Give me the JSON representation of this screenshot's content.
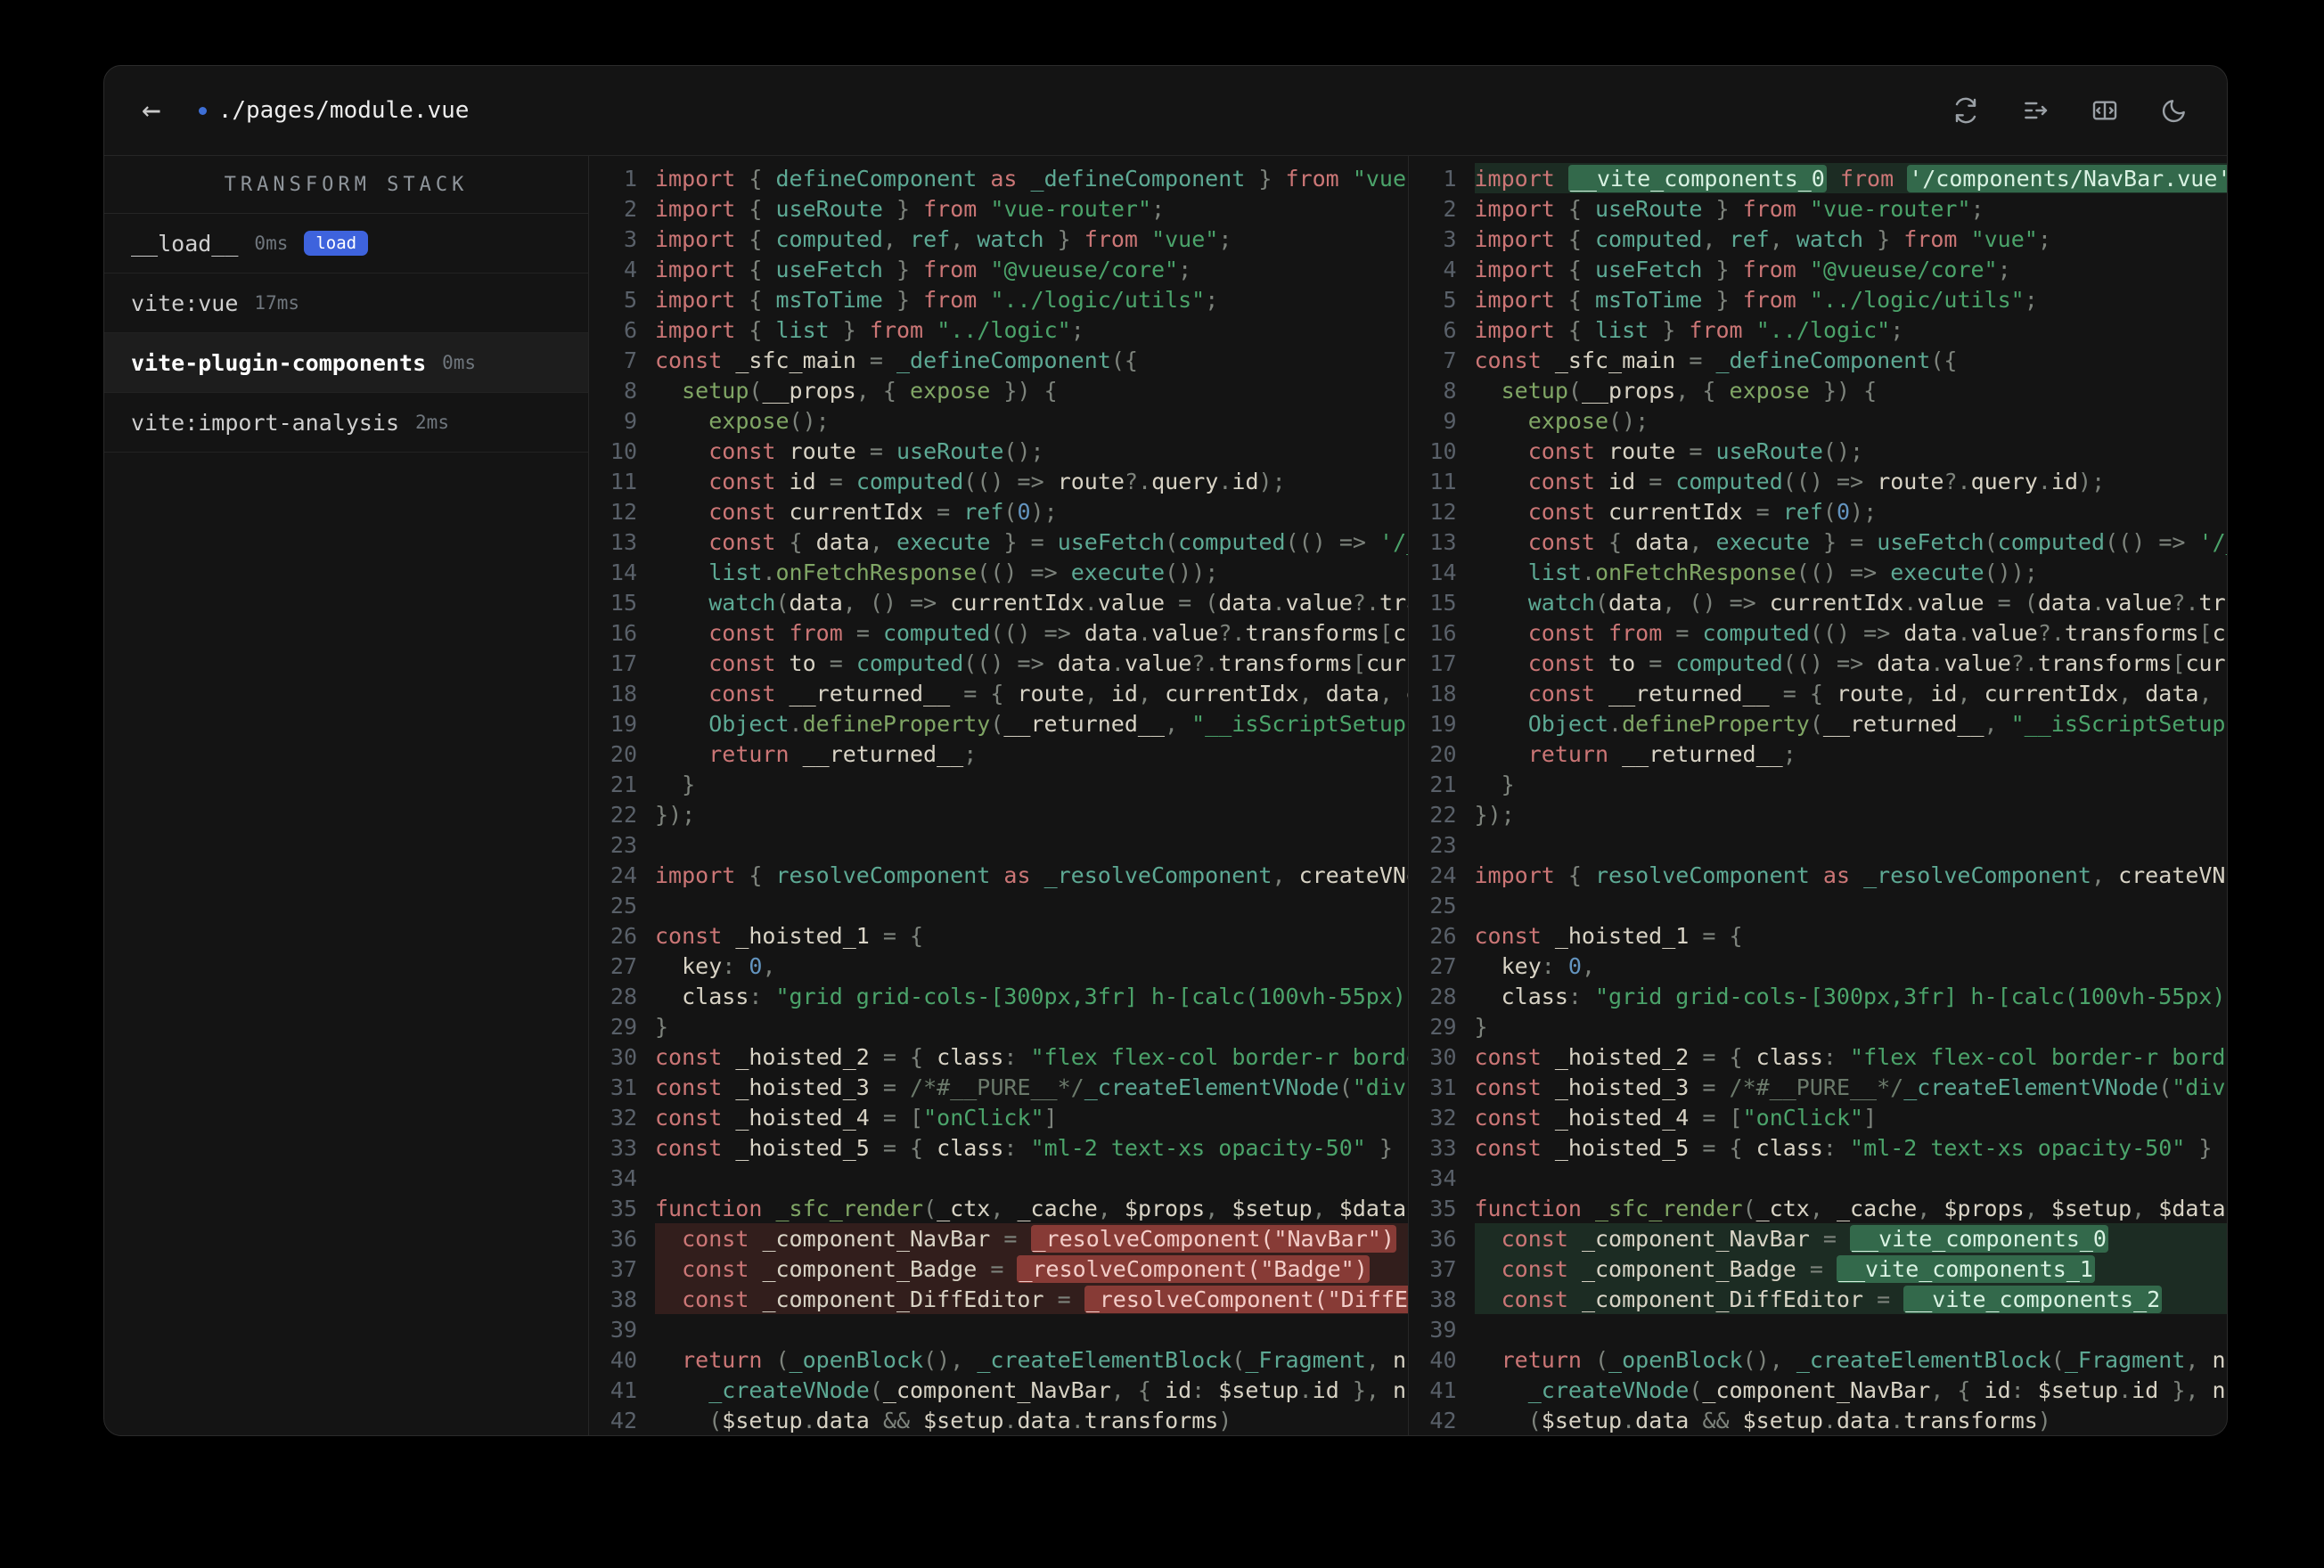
{
  "header": {
    "back_glyph": "←",
    "title": "./pages/module.vue",
    "icons": [
      "refresh-icon",
      "inline-diff-icon",
      "split-view-icon",
      "dark-mode-icon"
    ]
  },
  "sidebar": {
    "title": "TRANSFORM STACK",
    "items": [
      {
        "name": "__load__",
        "time": "0ms",
        "badge": "load",
        "selected": false
      },
      {
        "name": "vite:vue",
        "time": "17ms",
        "badge": null,
        "selected": false
      },
      {
        "name": "vite-plugin-components",
        "time": "0ms",
        "badge": null,
        "selected": true
      },
      {
        "name": "vite:import-analysis",
        "time": "2ms",
        "badge": null,
        "selected": false
      }
    ]
  },
  "diff": {
    "lines": [
      {
        "n": 1,
        "l": {
          "t": "import { defineComponent as _defineComponent } from \"vue\";"
        },
        "r": {
          "t": "import __vite_components_0 from '/components/NavBar.vue';",
          "hl": "add",
          "em": [
            "__vite_components_0",
            "'/components/NavBar.vue';"
          ]
        }
      },
      {
        "n": 2,
        "l": {
          "t": "import { useRoute } from \"vue-router\";"
        }
      },
      {
        "n": 3,
        "l": {
          "t": "import { computed, ref, watch } from \"vue\";"
        }
      },
      {
        "n": 4,
        "l": {
          "t": "import { useFetch } from \"@vueuse/core\";"
        }
      },
      {
        "n": 5,
        "l": {
          "t": "import { msToTime } from \"../logic/utils\";"
        }
      },
      {
        "n": 6,
        "l": {
          "t": "import { list } from \"../logic\";"
        }
      },
      {
        "n": 7,
        "l": {
          "t": "const _sfc_main = _defineComponent({"
        }
      },
      {
        "n": 8,
        "l": {
          "t": "  setup(__props, { expose }) {"
        }
      },
      {
        "n": 9,
        "l": {
          "t": "    expose();"
        }
      },
      {
        "n": 10,
        "l": {
          "t": "    const route = useRoute();"
        }
      },
      {
        "n": 11,
        "l": {
          "t": "    const id = computed(() => route?.query.id);"
        }
      },
      {
        "n": 12,
        "l": {
          "t": "    const currentIdx = ref(0);"
        }
      },
      {
        "n": 13,
        "l": {
          "t": "    const { data, execute } = useFetch(computed(() => '/_"
        }
      },
      {
        "n": 14,
        "l": {
          "t": "    list.onFetchResponse(() => execute());"
        }
      },
      {
        "n": 15,
        "l": {
          "t": "    watch(data, () => currentIdx.value = (data.value?.tra"
        }
      },
      {
        "n": 16,
        "l": {
          "t": "    const from = computed(() => data.value?.transforms[cu"
        }
      },
      {
        "n": 17,
        "l": {
          "t": "    const to = computed(() => data.value?.transforms[curr"
        }
      },
      {
        "n": 18,
        "l": {
          "t": "    const __returned__ = { route, id, currentIdx, data, e"
        }
      },
      {
        "n": 19,
        "l": {
          "t": "    Object.defineProperty(__returned__, \"__isScriptSetup\""
        }
      },
      {
        "n": 20,
        "l": {
          "t": "    return __returned__;"
        }
      },
      {
        "n": 21,
        "l": {
          "t": "  }"
        }
      },
      {
        "n": 22,
        "l": {
          "t": "});"
        }
      },
      {
        "n": 23,
        "l": {
          "t": ""
        }
      },
      {
        "n": 24,
        "l": {
          "t": "import { resolveComponent as _resolveComponent, createVNo"
        }
      },
      {
        "n": 25,
        "l": {
          "t": ""
        }
      },
      {
        "n": 26,
        "l": {
          "t": "const _hoisted_1 = {"
        }
      },
      {
        "n": 27,
        "l": {
          "t": "  key: 0,"
        }
      },
      {
        "n": 28,
        "l": {
          "t": "  class: \"grid grid-cols-[300px,3fr] h-[calc(100vh-55px)]"
        }
      },
      {
        "n": 29,
        "l": {
          "t": "}"
        }
      },
      {
        "n": 30,
        "l": {
          "t": "const _hoisted_2 = { class: \"flex flex-col border-r borde"
        }
      },
      {
        "n": 31,
        "l": {
          "t": "const _hoisted_3 = /*#__PURE__*/_createElementVNode(\"div\""
        }
      },
      {
        "n": 32,
        "l": {
          "t": "const _hoisted_4 = [\"onClick\"]"
        }
      },
      {
        "n": 33,
        "l": {
          "t": "const _hoisted_5 = { class: \"ml-2 text-xs opacity-50\" }"
        }
      },
      {
        "n": 34,
        "l": {
          "t": ""
        }
      },
      {
        "n": 35,
        "l": {
          "t": "function _sfc_render(_ctx, _cache, $props, $setup, $data,"
        }
      },
      {
        "n": 36,
        "l": {
          "t": "  const _component_NavBar = _resolveComponent(\"NavBar\")",
          "hl": "del",
          "em": [
            "_resolveComponent(\"NavBar\")"
          ]
        },
        "r": {
          "t": "  const _component_NavBar = __vite_components_0",
          "hl": "add",
          "em": [
            "__vite_components_0"
          ]
        }
      },
      {
        "n": 37,
        "l": {
          "t": "  const _component_Badge = _resolveComponent(\"Badge\")",
          "hl": "del",
          "em": [
            "_resolveComponent(\"Badge\")"
          ]
        },
        "r": {
          "t": "  const _component_Badge = __vite_components_1",
          "hl": "add",
          "em": [
            "__vite_components_1"
          ]
        }
      },
      {
        "n": 38,
        "l": {
          "t": "  const _component_DiffEditor = _resolveComponent(\"DiffEd",
          "hl": "del",
          "em": [
            "_resolveComponent(\"DiffEd"
          ]
        },
        "r": {
          "t": "  const _component_DiffEditor = __vite_components_2",
          "hl": "add",
          "em": [
            "__vite_components_2"
          ]
        }
      },
      {
        "n": 39,
        "l": {
          "t": ""
        }
      },
      {
        "n": 40,
        "l": {
          "t": "  return (_openBlock(), _createElementBlock(_Fragment, nu"
        }
      },
      {
        "n": 41,
        "l": {
          "t": "    _createVNode(_component_NavBar, { id: $setup.id }, nu"
        }
      },
      {
        "n": 42,
        "l": {
          "t": "    ($setup.data && $setup.data.transforms)"
        }
      }
    ]
  },
  "colors": {
    "background": "#000000",
    "window": "#141414",
    "border": "#262626",
    "badge_blue": "#3e63dd",
    "added_green": "#50b47d",
    "removed_red": "#db5850",
    "keyword": "#cb7676",
    "string": "#4ba36a",
    "number": "#6394bf"
  }
}
